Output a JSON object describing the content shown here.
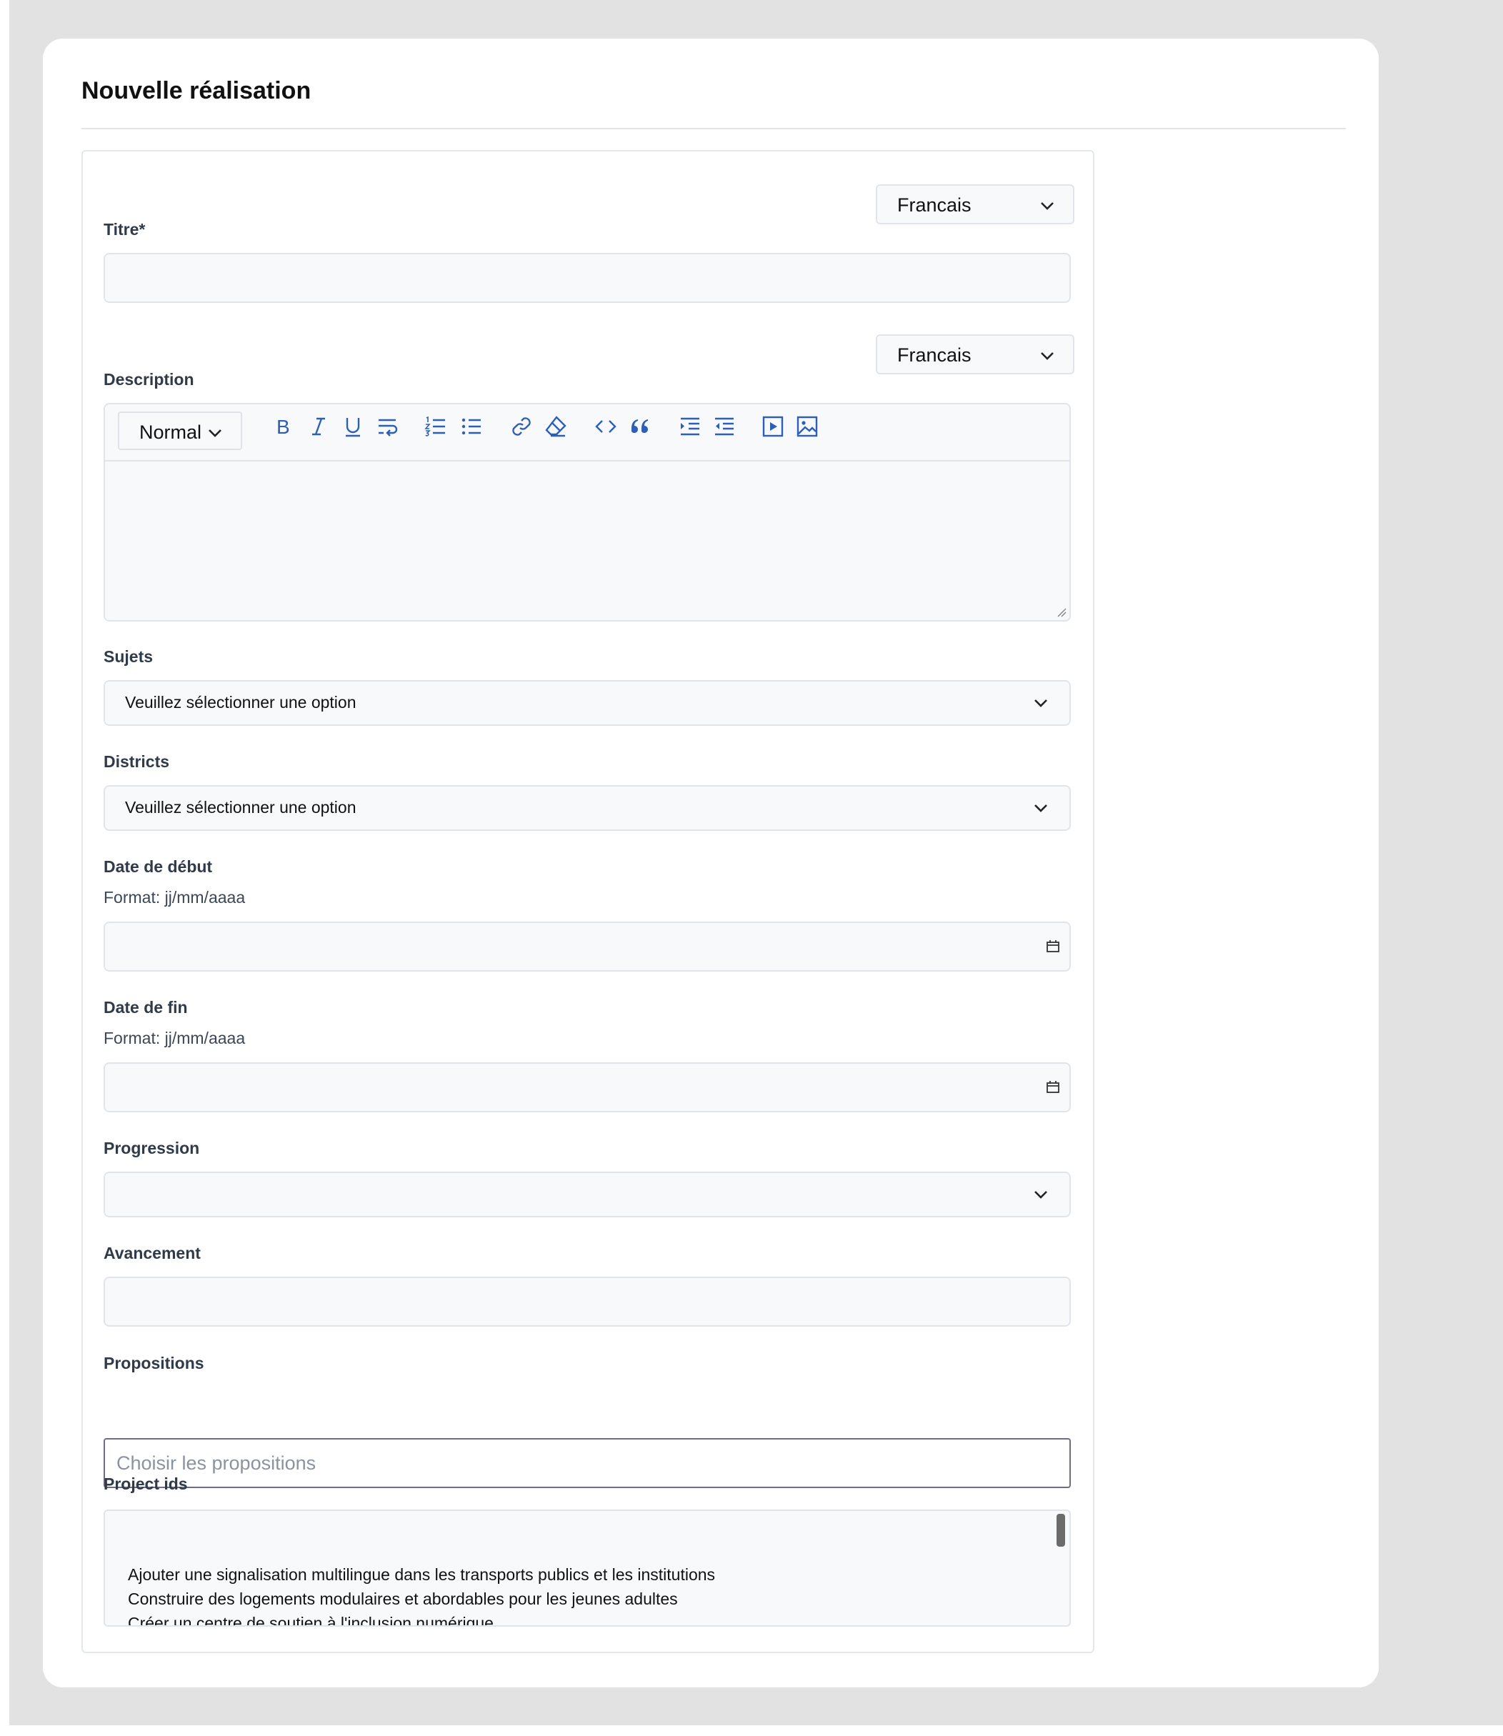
{
  "page": {
    "title": "Nouvelle réalisation"
  },
  "titre": {
    "label": "Titre*",
    "language": "Francais",
    "value": ""
  },
  "description": {
    "label": "Description",
    "language": "Francais",
    "format": "Normal",
    "toolbar_icons": [
      "bold-icon",
      "italic-icon",
      "underline-icon",
      "strikethrough-icon",
      "ordered-list-icon",
      "bullet-list-icon",
      "link-icon",
      "clear-format-icon",
      "code-icon",
      "quote-icon",
      "indent-icon",
      "outdent-icon",
      "video-icon",
      "image-icon"
    ],
    "value": ""
  },
  "sujets": {
    "label": "Sujets",
    "value": "Veuillez sélectionner une option"
  },
  "districts": {
    "label": "Districts",
    "value": "Veuillez sélectionner une option"
  },
  "date_debut": {
    "label": "Date de début",
    "hint": "Format: jj/mm/aaaa",
    "value": ""
  },
  "date_fin": {
    "label": "Date de fin",
    "hint": "Format: jj/mm/aaaa",
    "value": ""
  },
  "progression": {
    "label": "Progression",
    "value": ""
  },
  "avancement": {
    "label": "Avancement",
    "value": ""
  },
  "propositions": {
    "label": "Propositions",
    "placeholder": "Choisir les propositions"
  },
  "project_ids": {
    "label": "Project ids",
    "options": [
      "Ajouter une signalisation multilingue dans les transports publics et les institutions",
      "Construire des logements modulaires et abordables pour les jeunes adultes",
      "Créer un centre de soutien à l'inclusion numérique"
    ]
  },
  "colors": {
    "accent": "#2d5fb8",
    "label": "#2f3a4a",
    "border": "#e1e4ea"
  }
}
